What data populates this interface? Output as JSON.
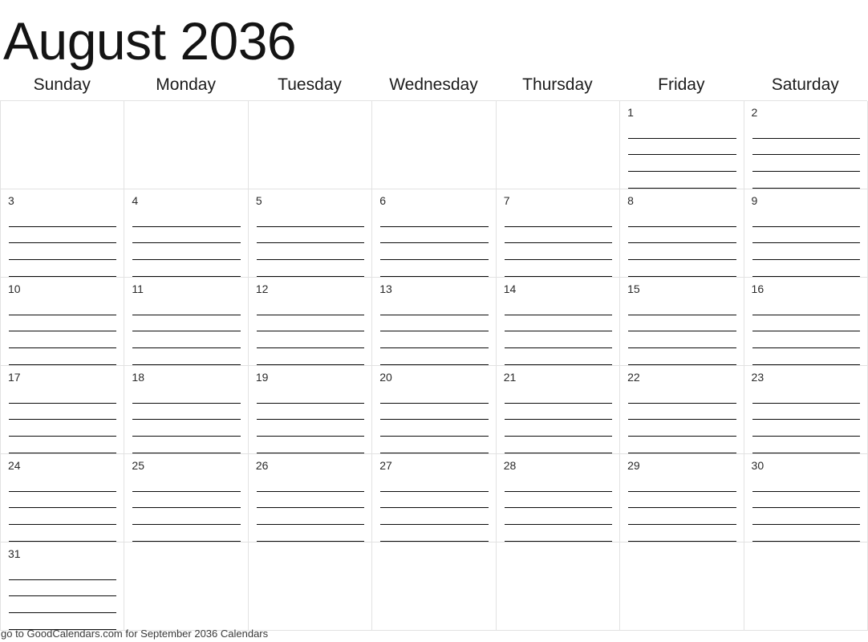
{
  "title": "August 2036",
  "weekday_headers": [
    "Sunday",
    "Monday",
    "Tuesday",
    "Wednesday",
    "Thursday",
    "Friday",
    "Saturday"
  ],
  "footer": "go to GoodCalendars.com for September 2036 Calendars",
  "colors": {
    "grid_line": "#e2e2e2",
    "write_line": "#0b0b0b",
    "text": "#141414",
    "day_number": "#2a2a2a",
    "background": "#ffffff"
  },
  "layout": {
    "columns": 7,
    "rows": 6,
    "lines_per_day": 4
  },
  "weeks": [
    [
      {
        "date": "",
        "lines": 0
      },
      {
        "date": "",
        "lines": 0
      },
      {
        "date": "",
        "lines": 0
      },
      {
        "date": "",
        "lines": 0
      },
      {
        "date": "",
        "lines": 0
      },
      {
        "date": "1",
        "lines": 4
      },
      {
        "date": "2",
        "lines": 4
      }
    ],
    [
      {
        "date": "3",
        "lines": 4
      },
      {
        "date": "4",
        "lines": 4
      },
      {
        "date": "5",
        "lines": 4
      },
      {
        "date": "6",
        "lines": 4
      },
      {
        "date": "7",
        "lines": 4
      },
      {
        "date": "8",
        "lines": 4
      },
      {
        "date": "9",
        "lines": 4
      }
    ],
    [
      {
        "date": "10",
        "lines": 4
      },
      {
        "date": "11",
        "lines": 4
      },
      {
        "date": "12",
        "lines": 4
      },
      {
        "date": "13",
        "lines": 4
      },
      {
        "date": "14",
        "lines": 4
      },
      {
        "date": "15",
        "lines": 4
      },
      {
        "date": "16",
        "lines": 4
      }
    ],
    [
      {
        "date": "17",
        "lines": 4
      },
      {
        "date": "18",
        "lines": 4
      },
      {
        "date": "19",
        "lines": 4
      },
      {
        "date": "20",
        "lines": 4
      },
      {
        "date": "21",
        "lines": 4
      },
      {
        "date": "22",
        "lines": 4
      },
      {
        "date": "23",
        "lines": 4
      }
    ],
    [
      {
        "date": "24",
        "lines": 4
      },
      {
        "date": "25",
        "lines": 4
      },
      {
        "date": "26",
        "lines": 4
      },
      {
        "date": "27",
        "lines": 4
      },
      {
        "date": "28",
        "lines": 4
      },
      {
        "date": "29",
        "lines": 4
      },
      {
        "date": "30",
        "lines": 4
      }
    ],
    [
      {
        "date": "31",
        "lines": 4
      },
      {
        "date": "",
        "lines": 0
      },
      {
        "date": "",
        "lines": 0
      },
      {
        "date": "",
        "lines": 0
      },
      {
        "date": "",
        "lines": 0
      },
      {
        "date": "",
        "lines": 0
      },
      {
        "date": "",
        "lines": 0
      }
    ]
  ]
}
